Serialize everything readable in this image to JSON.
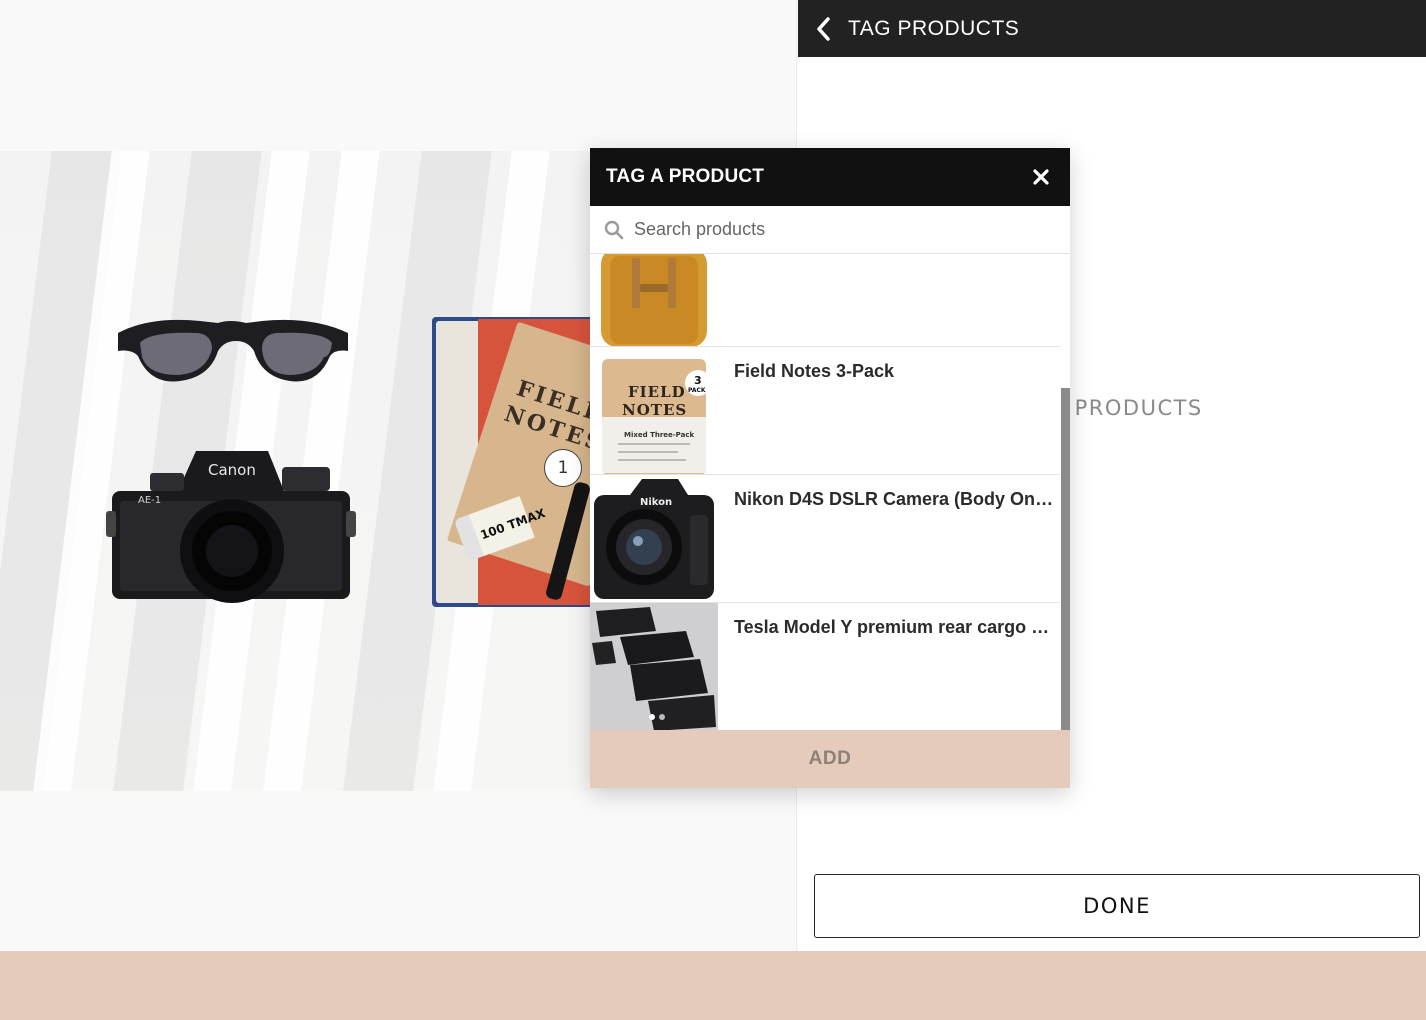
{
  "right_panel": {
    "title": "TAG PRODUCTS",
    "hint": "E TO TAG PRODUCTS",
    "done_label": "DONE"
  },
  "photo": {
    "tag_marker": "1",
    "camera_brand": "Canon",
    "camera_model": "AE-1",
    "notebook_text": "FIELD NOTES",
    "film_text": "100 TMAX"
  },
  "modal": {
    "title": "TAG A PRODUCT",
    "search_placeholder": "Search products",
    "add_label": "ADD",
    "items": [
      {
        "name": "",
        "thumb": "backpack"
      },
      {
        "name": "Field Notes 3-Pack",
        "thumb": "field-notes",
        "thumb_text_1": "FIELD",
        "thumb_text_2": "NOTES",
        "thumb_badge": "3",
        "thumb_badge_sub": "PACK",
        "thumb_caption": "Mixed Three-Pack"
      },
      {
        "name": "Nikon D4S DSLR Camera (Body Only)",
        "thumb": "nikon-camera",
        "thumb_brand": "Nikon"
      },
      {
        "name": "Tesla Model Y premium rear cargo lin...",
        "thumb": "cargo-mats"
      }
    ]
  },
  "colors": {
    "header_bg": "#222222",
    "modal_header_bg": "#111111",
    "accent_peach": "#e4cbbc"
  }
}
